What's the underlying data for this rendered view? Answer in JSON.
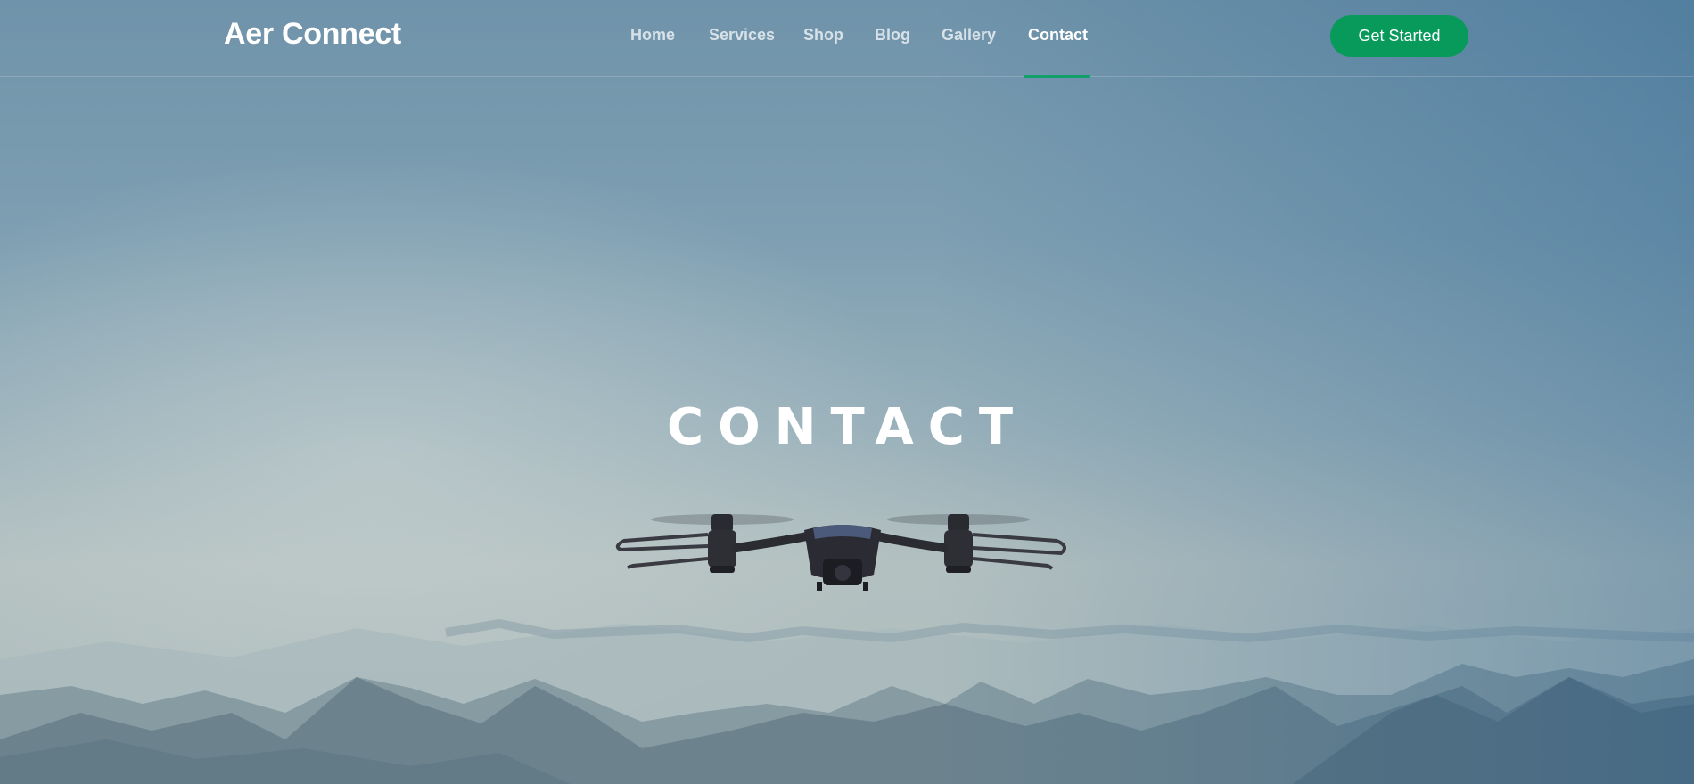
{
  "header": {
    "logo": "Aer Connect",
    "nav": [
      {
        "label": "Home",
        "active": false
      },
      {
        "label": "Services",
        "active": false
      },
      {
        "label": "Shop",
        "active": false
      },
      {
        "label": "Blog",
        "active": false
      },
      {
        "label": "Gallery",
        "active": false
      },
      {
        "label": "Contact",
        "active": true
      }
    ],
    "cta_label": "Get Started"
  },
  "hero": {
    "title": "CONTACT"
  },
  "colors": {
    "accent": "#079a5b",
    "underline": "#0fa169",
    "text": "#ffffff"
  }
}
